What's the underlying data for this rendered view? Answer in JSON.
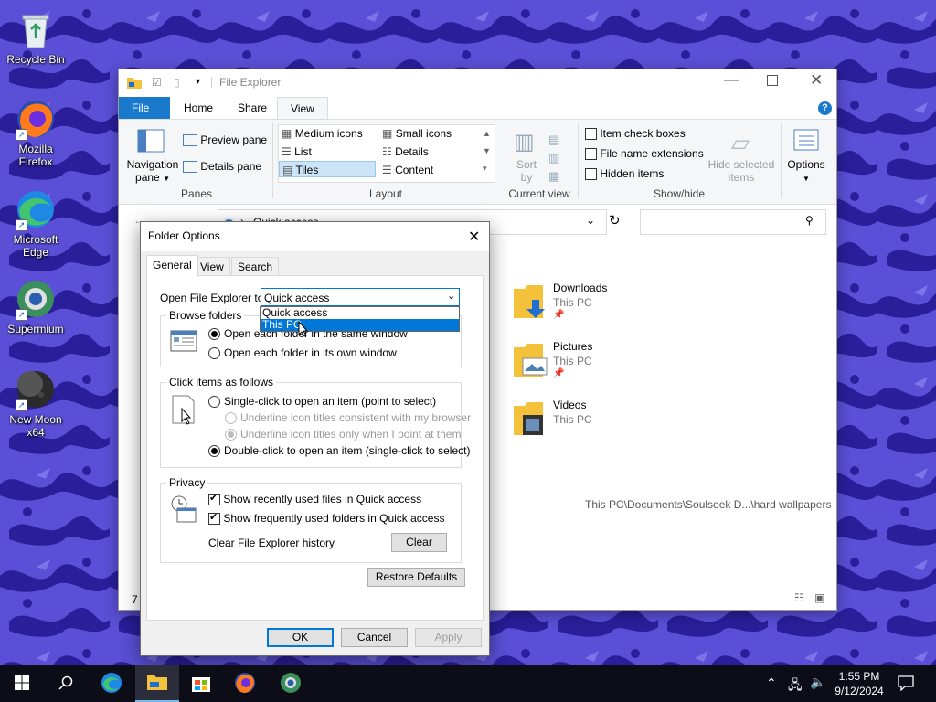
{
  "desktop": {
    "icons": [
      {
        "label": "Recycle Bin",
        "icon": "recycle-bin-icon"
      },
      {
        "label": "Mozilla Firefox",
        "icon": "firefox-icon"
      },
      {
        "label": "Microsoft Edge",
        "icon": "edge-icon"
      },
      {
        "label": "Supermium",
        "icon": "supermium-icon"
      },
      {
        "label": "New Moon x64",
        "icon": "new-moon-icon"
      }
    ]
  },
  "explorer": {
    "title": "File Explorer",
    "tabs": {
      "file": "File",
      "home": "Home",
      "share": "Share",
      "view": "View"
    },
    "ribbon": {
      "panes": {
        "navigation_pane": "Navigation pane",
        "preview_pane": "Preview pane",
        "details_pane": "Details pane",
        "group": "Panes"
      },
      "layout": {
        "medium_icons": "Medium icons",
        "small_icons": "Small icons",
        "list": "List",
        "details": "Details",
        "tiles": "Tiles",
        "content": "Content",
        "group": "Layout"
      },
      "current_view": {
        "sort_by": "Sort by",
        "group": "Current view"
      },
      "show_hide": {
        "item_check_boxes": "Item check boxes",
        "file_name_extensions": "File name extensions",
        "hidden_items": "Hidden items",
        "hide_selected_items": "Hide selected items",
        "group": "Show/hide"
      },
      "options": "Options"
    },
    "address": "Quick access",
    "files": [
      {
        "name": "Downloads",
        "location": "This PC"
      },
      {
        "name": "Pictures",
        "location": "This PC"
      },
      {
        "name": "Videos",
        "location": "This PC"
      }
    ],
    "recent_path": "This PC\\Documents\\Soulseek D...\\hard wallpapers",
    "status_count": "7"
  },
  "dialog": {
    "title": "Folder Options",
    "tabs": {
      "general": "General",
      "view": "View",
      "search": "Search"
    },
    "open_label": "Open File Explorer to:",
    "open_value": "Quick access",
    "dropdown_options": [
      "Quick access",
      "This PC"
    ],
    "browse_folders": {
      "legend": "Browse folders",
      "same_window": "Open each folder in the same window",
      "own_window": "Open each folder in its own window"
    },
    "click_items": {
      "legend": "Click items as follows",
      "single_click": "Single-click to open an item (point to select)",
      "underline_consistent": "Underline icon titles consistent with my browser",
      "underline_point": "Underline icon titles only when I point at them",
      "double_click": "Double-click to open an item (single-click to select)"
    },
    "privacy": {
      "legend": "Privacy",
      "recent_files": "Show recently used files in Quick access",
      "frequent_folders": "Show frequently used folders in Quick access",
      "clear_history": "Clear File Explorer history",
      "clear_button": "Clear"
    },
    "restore_defaults": "Restore Defaults",
    "ok": "OK",
    "cancel": "Cancel",
    "apply": "Apply"
  },
  "taskbar": {
    "time": "1:55 PM",
    "date": "9/12/2024"
  },
  "colors": {
    "accent": "#0078d7",
    "wallpaper_base": "#5a4fd6",
    "wallpaper_dark": "#2a1e9a",
    "taskbar": "#0c0d17"
  }
}
